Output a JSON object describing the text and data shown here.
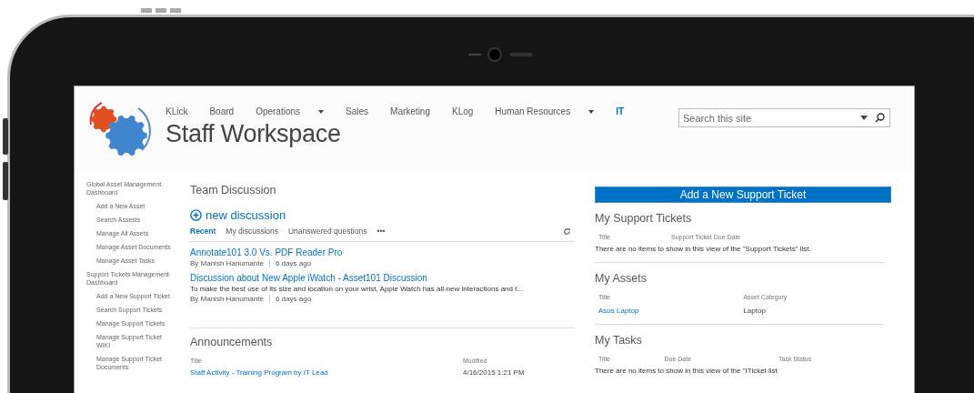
{
  "site": {
    "title": "Staff Workspace",
    "search": {
      "placeholder": "Search this site"
    }
  },
  "top_nav": [
    {
      "label": "KLick",
      "dropdown": false,
      "selected": false
    },
    {
      "label": "Board",
      "dropdown": false,
      "selected": false
    },
    {
      "label": "Operations",
      "dropdown": true,
      "selected": false
    },
    {
      "label": "Sales",
      "dropdown": false,
      "selected": false
    },
    {
      "label": "Marketing",
      "dropdown": false,
      "selected": false
    },
    {
      "label": "KLog",
      "dropdown": false,
      "selected": false
    },
    {
      "label": "Human Resources",
      "dropdown": true,
      "selected": false
    },
    {
      "label": "IT",
      "dropdown": false,
      "selected": true
    }
  ],
  "sidebar": {
    "items": [
      {
        "label": "Global Asset Management Dashboard",
        "children": [
          {
            "label": "Add a New Asset"
          },
          {
            "label": "Search Assests"
          },
          {
            "label": "Manage All Assets"
          },
          {
            "label": "Manage Asset Documents"
          },
          {
            "label": "Manage Asset Tasks"
          }
        ]
      },
      {
        "label": "Support Tickets Management Dashboard",
        "children": [
          {
            "label": "Add a New Support Ticket"
          },
          {
            "label": "Search Support Tickets"
          },
          {
            "label": "Manage Support Tickets"
          },
          {
            "label": "Manage Support Ticket WIKI"
          },
          {
            "label": "Manage Support Ticket Documents"
          }
        ]
      }
    ]
  },
  "team_discussion": {
    "title": "Team Discussion",
    "new_label": "new discussion",
    "tabs": [
      {
        "label": "Recent",
        "selected": true
      },
      {
        "label": "My discussions",
        "selected": false
      },
      {
        "label": "Unanswered questions",
        "selected": false
      }
    ],
    "more": "•••",
    "posts": [
      {
        "title": "Annotate101 3.0 Vs. PDF Reader Pro",
        "author": "By Manish Hanumante",
        "age": "6 days ago"
      },
      {
        "title": "Discussion about New Apple iWatch - Asset101 Discussion",
        "excerpt": "To make the best use of its size and location on your wrist, Apple Watch has all-new interactions and t...",
        "author": "By Manish Hanumante",
        "age": "6 days ago"
      }
    ]
  },
  "announcements": {
    "title": "Announcements",
    "columns": [
      "Title",
      "Modified"
    ],
    "rows": [
      [
        "Staff Activity - Training Program by IT Lead",
        "4/16/2015 1:21 PM"
      ]
    ]
  },
  "add_ticket_button": "Add a New Support Ticket",
  "my_support_tickets": {
    "title": "My Support Tickets",
    "columns": [
      "Title",
      "Support Ticket Due Date"
    ],
    "empty_message": "There are no items to show in this view of the \"Support Tickets\" list."
  },
  "my_assets": {
    "title": "My Assets",
    "columns": [
      "Title",
      "Asset Category"
    ],
    "rows": [
      [
        "Asus Laptop",
        "Laptop"
      ]
    ]
  },
  "my_tasks": {
    "title": "My Tasks",
    "columns": [
      "Title",
      "Due Date",
      "Task Status"
    ],
    "empty_message": "There are no items to show in this view of the \"ITicket list"
  }
}
